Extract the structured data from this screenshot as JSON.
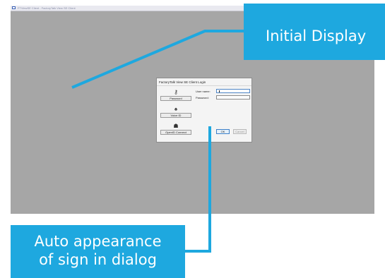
{
  "window": {
    "title": "FTViewSE Client - FactoryTalk View SE Client"
  },
  "dialog": {
    "title": "FactoryTalk View SE Client Login",
    "methods": [
      {
        "icon": "key-icon",
        "glyph": "⚷",
        "label": "Password"
      },
      {
        "icon": "badge-icon",
        "glyph": "♠",
        "label": "Voice ID"
      },
      {
        "icon": "badge-card-icon",
        "glyph": "☗",
        "label": "OpenID Connect"
      }
    ],
    "username_label": "User name:",
    "username_value": "",
    "password_label": "Password:",
    "password_value": "",
    "ok_label": "OK",
    "cancel_label": "Cancel"
  },
  "callouts": {
    "top": "Initial Display",
    "bottom_line1": "Auto appearance",
    "bottom_line2": "of sign in dialog"
  },
  "colors": {
    "callout": "#1ea8df",
    "screen_background": "#a6a6a6",
    "ok_border": "#3c7fc7"
  }
}
